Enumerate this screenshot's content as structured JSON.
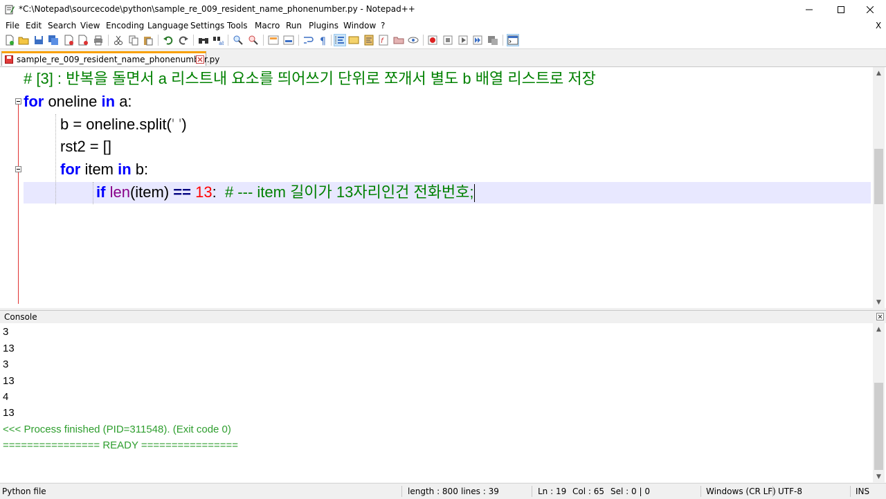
{
  "window": {
    "title": "*C:\\Notepad\\sourcecode\\python\\sample_re_009_resident_name_phonenumber.py - Notepad++"
  },
  "menu": {
    "items": [
      "File",
      "Edit",
      "Search",
      "View",
      "Encoding",
      "Language",
      "Settings",
      "Tools",
      "Macro",
      "Run",
      "Plugins",
      "Window",
      "?"
    ],
    "close_x": "X"
  },
  "tab": {
    "label": "sample_re_009_resident_name_phonenumber.py"
  },
  "editor": {
    "lines": {
      "l1_comment": "# [3] : 반복을 돌면서 a 리스트내 요소를 띄어쓰기 단위로 쪼개서 별도 b 배열 리스트로 저장",
      "l2_kw1": "for",
      "l2_var": " oneline ",
      "l2_kw2": "in",
      "l2_rest": " a:",
      "l3_a": "b = oneline.split(",
      "l3_str": "' '",
      "l3_b": ")",
      "l4": "rst2 = []",
      "l5_kw1": "for",
      "l5_var": " item ",
      "l5_kw2": "in",
      "l5_rest": " b:",
      "l6_kw": "if",
      "l6_fn": "len",
      "l6_arg": "(item)",
      "l6_op": "==",
      "l6_num": "13",
      "l6_colon": ":",
      "l6_comment": "# --- item 길이가 13자리인건 전화번호;"
    }
  },
  "console": {
    "title": "Console",
    "lines": [
      "3",
      "13",
      "3",
      "13",
      "4",
      "13"
    ],
    "process_line": "<<< Process finished (PID=311548). (Exit code 0)",
    "ready_line": "================ READY ================"
  },
  "statusbar": {
    "file_type": "Python file",
    "length": "length : 800",
    "lines": "lines : 39",
    "ln": "Ln : 19",
    "col": "Col : 65",
    "sel": "Sel : 0 | 0",
    "eol": "Windows (CR LF)",
    "encoding": "UTF-8",
    "mode": "INS"
  },
  "icons": [
    "notepad-app-icon",
    "minimize-icon",
    "maximize-icon",
    "close-icon",
    "new-file-icon",
    "open-file-icon",
    "save-icon",
    "save-all-icon",
    "close-file-icon",
    "close-all-icon",
    "print-icon",
    "cut-icon",
    "copy-icon",
    "paste-icon",
    "undo-icon",
    "redo-icon",
    "find-icon",
    "replace-icon",
    "zoom-in-icon",
    "zoom-out-icon",
    "sync-vertical-icon",
    "sync-horizontal-icon",
    "word-wrap-icon",
    "show-all-chars-icon",
    "indent-guide-icon",
    "user-defined-language-icon",
    "document-map-icon",
    "function-list-icon",
    "folder-as-workspace-icon",
    "monitoring-icon",
    "record-macro-icon",
    "stop-macro-icon",
    "play-macro-icon",
    "run-macro-multiple-icon",
    "save-macro-icon",
    "console-toggle-icon"
  ]
}
